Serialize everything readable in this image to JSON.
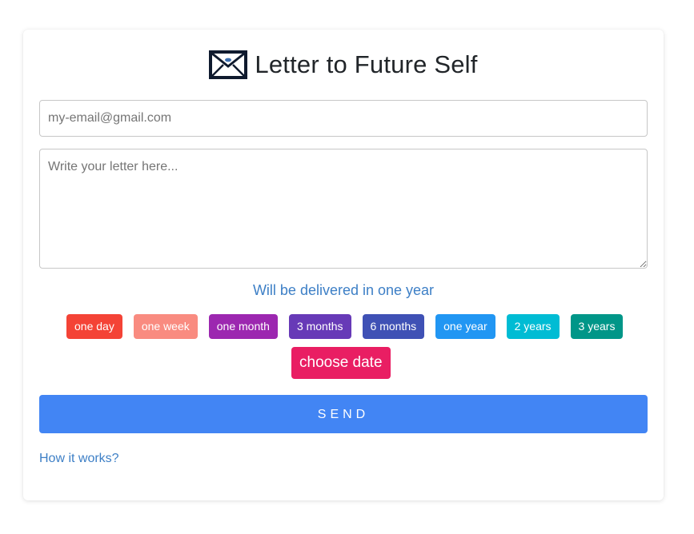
{
  "header": {
    "title": "Letter to Future Self",
    "icon": "envelope-icon"
  },
  "form": {
    "email_placeholder": "my-email@gmail.com",
    "letter_placeholder": "Write your letter here...",
    "delivery_text": "Will be delivered in one year",
    "options": [
      {
        "label": "one day",
        "color": "#f44336"
      },
      {
        "label": "one week",
        "color": "#f98b80"
      },
      {
        "label": "one month",
        "color": "#9c27b0"
      },
      {
        "label": "3 months",
        "color": "#673ab7"
      },
      {
        "label": "6 months",
        "color": "#3f51b5"
      },
      {
        "label": "one year",
        "color": "#2196f3"
      },
      {
        "label": "2 years",
        "color": "#00bcd4"
      },
      {
        "label": "3 years",
        "color": "#009688"
      }
    ],
    "choose_date_label": "choose date",
    "choose_date_color": "#e91e63",
    "send_label": "SEND",
    "send_color": "#4285f4"
  },
  "footer": {
    "how_it_works": "How it works?"
  }
}
